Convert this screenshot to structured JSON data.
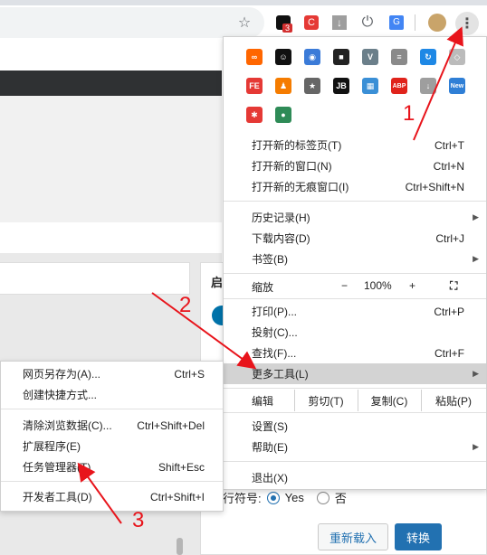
{
  "extensions": [
    {
      "name": "infinity-ext-icon",
      "glyph": "∞",
      "color": "#ff6600"
    },
    {
      "name": "monster-ext-icon",
      "glyph": "☺",
      "color": "#111111"
    },
    {
      "name": "camera-ext-icon",
      "glyph": "◉",
      "color": "#3b7bd8"
    },
    {
      "name": "cube-ext-icon",
      "glyph": "■",
      "color": "#222222"
    },
    {
      "name": "v-ext-icon",
      "glyph": "V",
      "color": "#6b7f8a"
    },
    {
      "name": "notes-ext-icon",
      "glyph": "≡",
      "color": "#8a8a8a"
    },
    {
      "name": "refresh-ext-icon",
      "glyph": "↻",
      "color": "#1e88e5"
    },
    {
      "name": "shield-ext-icon",
      "glyph": "◇",
      "color": "#bbbbbb"
    },
    {
      "name": "fe-ext-icon",
      "glyph": "FE",
      "color": "#e53935"
    },
    {
      "name": "people-ext-icon",
      "glyph": "♟",
      "color": "#f57c00"
    },
    {
      "name": "star-ext-icon",
      "glyph": "★",
      "color": "#666666"
    },
    {
      "name": "jb-ext-icon",
      "glyph": "JB",
      "color": "#111111"
    },
    {
      "name": "grid-ext-icon",
      "glyph": "▦",
      "color": "#3a8fd6"
    },
    {
      "name": "abp-ext-icon",
      "glyph": "ABP",
      "color": "#e0231b"
    },
    {
      "name": "download-ext-icon",
      "glyph": "↓",
      "color": "#9e9e9e"
    },
    {
      "name": "new-ext-icon",
      "glyph": "New",
      "color": "#2f7fd6"
    },
    {
      "name": "pinwheel-ext-icon",
      "glyph": "✱",
      "color": "#e53935"
    },
    {
      "name": "globe-ext-icon",
      "glyph": "●",
      "color": "#2e8b57"
    }
  ],
  "toolbar": {
    "badge_count": "3"
  },
  "menu": {
    "new_tab": "打开新的标签页(T)",
    "new_tab_sc": "Ctrl+T",
    "new_window": "打开新的窗口(N)",
    "new_window_sc": "Ctrl+N",
    "incognito": "打开新的无痕窗口(I)",
    "incognito_sc": "Ctrl+Shift+N",
    "history": "历史记录(H)",
    "downloads": "下载内容(D)",
    "downloads_sc": "Ctrl+J",
    "bookmarks": "书签(B)",
    "zoom": "缩放",
    "zoom_minus": "−",
    "zoom_value": "100%",
    "zoom_plus": "+",
    "print": "打印(P)...",
    "print_sc": "Ctrl+P",
    "cast": "投射(C)...",
    "find": "查找(F)...",
    "find_sc": "Ctrl+F",
    "more_tools": "更多工具(L)",
    "edit": "编辑",
    "cut": "剪切(T)",
    "copy": "复制(C)",
    "paste": "粘贴(P)",
    "settings": "设置(S)",
    "help": "帮助(E)",
    "exit": "退出(X)"
  },
  "submenu": {
    "save_page": "网页另存为(A)...",
    "save_page_sc": "Ctrl+S",
    "create_shortcut": "创建快捷方式...",
    "clear_data": "清除浏览数据(C)...",
    "clear_data_sc": "Ctrl+Shift+Del",
    "extensions": "扩展程序(E)",
    "task_manager": "任务管理器(T)",
    "task_manager_sc": "Shift+Esc",
    "dev_tools": "开发者工具(D)",
    "dev_tools_sc": "Ctrl+Shift+I"
  },
  "page": {
    "panel_title": "启",
    "radio_label": "行符号:",
    "radio_yes": "Yes",
    "radio_no": "否",
    "reload_button": "重新载入",
    "convert_button": "转换"
  },
  "annotations": {
    "step1": "1",
    "step2": "2",
    "step3": "3",
    "arrow_color": "#e8141b"
  }
}
